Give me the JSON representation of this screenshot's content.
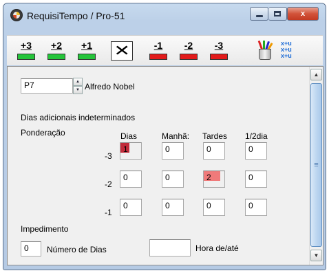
{
  "window": {
    "title": "RequisiTempo / Pro-51",
    "buttons": {
      "minimize": "minimize",
      "maximize": "maximize",
      "close": "x"
    }
  },
  "toolbar": {
    "items": [
      {
        "label": "+3",
        "color": "#25c43a"
      },
      {
        "label": "+2",
        "color": "#25c43a"
      },
      {
        "label": "+1",
        "color": "#25c43a"
      },
      {
        "label": "X",
        "color": "#000000"
      },
      {
        "label": "-1",
        "color": "#e21b1b"
      },
      {
        "label": "-2",
        "color": "#e21b1b"
      },
      {
        "label": "-3",
        "color": "#e21b1b"
      }
    ],
    "icons": [
      "pencil-cup-icon",
      "xyu-icon"
    ],
    "xyu_lines": [
      "x+u",
      "x+u",
      "x+u"
    ]
  },
  "form": {
    "code": "P7",
    "name": "Alfredo Nobel",
    "indeterminate_label": "Dias adicionais indeterminados",
    "ponderacao_label": "Ponderação",
    "columns": [
      "Dias",
      "Manhã:",
      "Tardes",
      "1/2dia"
    ],
    "rows": [
      {
        "label": "-3",
        "values": [
          "1",
          "0",
          "0",
          "0"
        ]
      },
      {
        "label": "-2",
        "values": [
          "0",
          "0",
          "2",
          "0"
        ]
      },
      {
        "label": "-1",
        "values": [
          "0",
          "0",
          "0",
          "0"
        ]
      }
    ],
    "highlight_colors": {
      "dark": "#c12b3a",
      "light": "#f07a7a"
    },
    "impedimento_label": "Impedimento",
    "dias_value": "0",
    "dias_label": "Número de Dias",
    "hora_value": "",
    "hora_label": "Hora de/até"
  }
}
